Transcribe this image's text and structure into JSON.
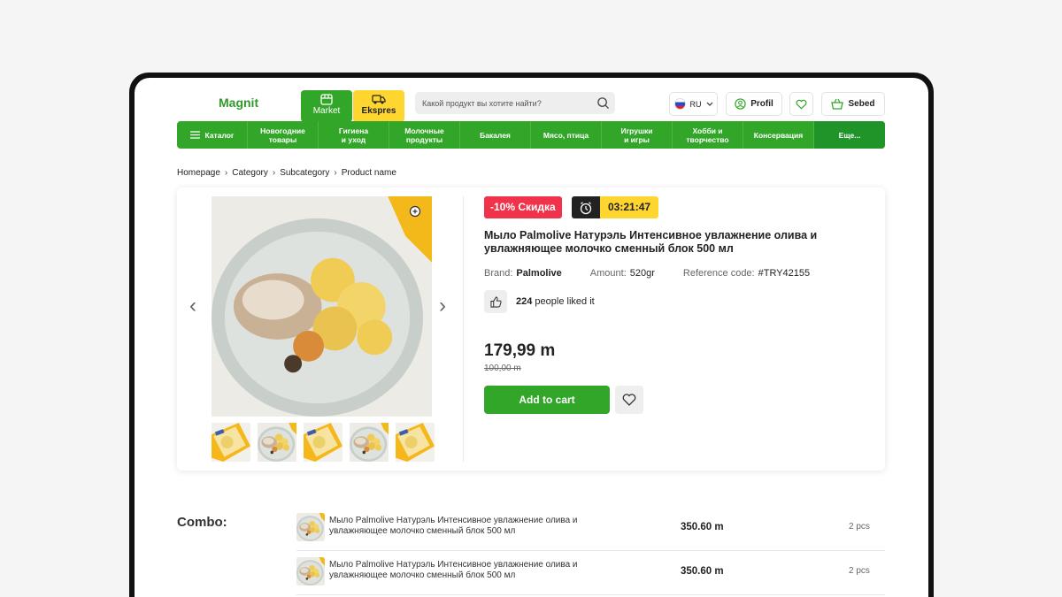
{
  "header": {
    "logo": "Magnit",
    "tab_market": "Market",
    "tab_ekspres": "Ekspres",
    "search_placeholder": "Какой продукт вы хотите найти?",
    "lang": "RU",
    "profile": "Profil",
    "cart": "Sebed"
  },
  "nav": {
    "catalog": "Каталог",
    "items": [
      "Новогодние\nтовары",
      "Гигиена\nи уход",
      "Молочные\nпродукты",
      "Бакалея",
      "Мясо, птица",
      "Игрушки\nи игры",
      "Хобби и\nтворчество",
      "Консервация",
      "Еще..."
    ]
  },
  "breadcrumb": [
    "Homepage",
    "Category",
    "Subcategory",
    "Product name"
  ],
  "product": {
    "discount_badge": "-10% Скидка",
    "timer": "03:21:47",
    "title": "Мыло Palmolive Натурэль Интенсивное увлажнение олива и увлажняющее молочко сменный блок 500 мл",
    "brand_label": "Brand:",
    "brand": "Palmolive",
    "amount_label": "Amount:",
    "amount": "520gr",
    "ref_label": "Reference code:",
    "ref": "#TRY42155",
    "likes_count": "224",
    "likes_text": "people liked it",
    "price": "179,99 m",
    "old_price": "100,00 m",
    "add_to_cart": "Add to cart"
  },
  "combo": {
    "title": "Combo:",
    "items": [
      {
        "name": "Мыло Palmolive Натурэль Интенсивное увлажнение олива и увлажняющее молочко сменный блок 500 мл",
        "price": "350.60 m",
        "qty": "2 pcs"
      },
      {
        "name": "Мыло Palmolive Натурэль Интенсивное увлажнение олива и увлажняющее молочко сменный блок 500 мл",
        "price": "350.60 m",
        "qty": "2 pcs"
      }
    ]
  },
  "colors": {
    "brand_green": "#32a628",
    "accent_yellow": "#ffd530",
    "sale_red": "#f0334a"
  }
}
